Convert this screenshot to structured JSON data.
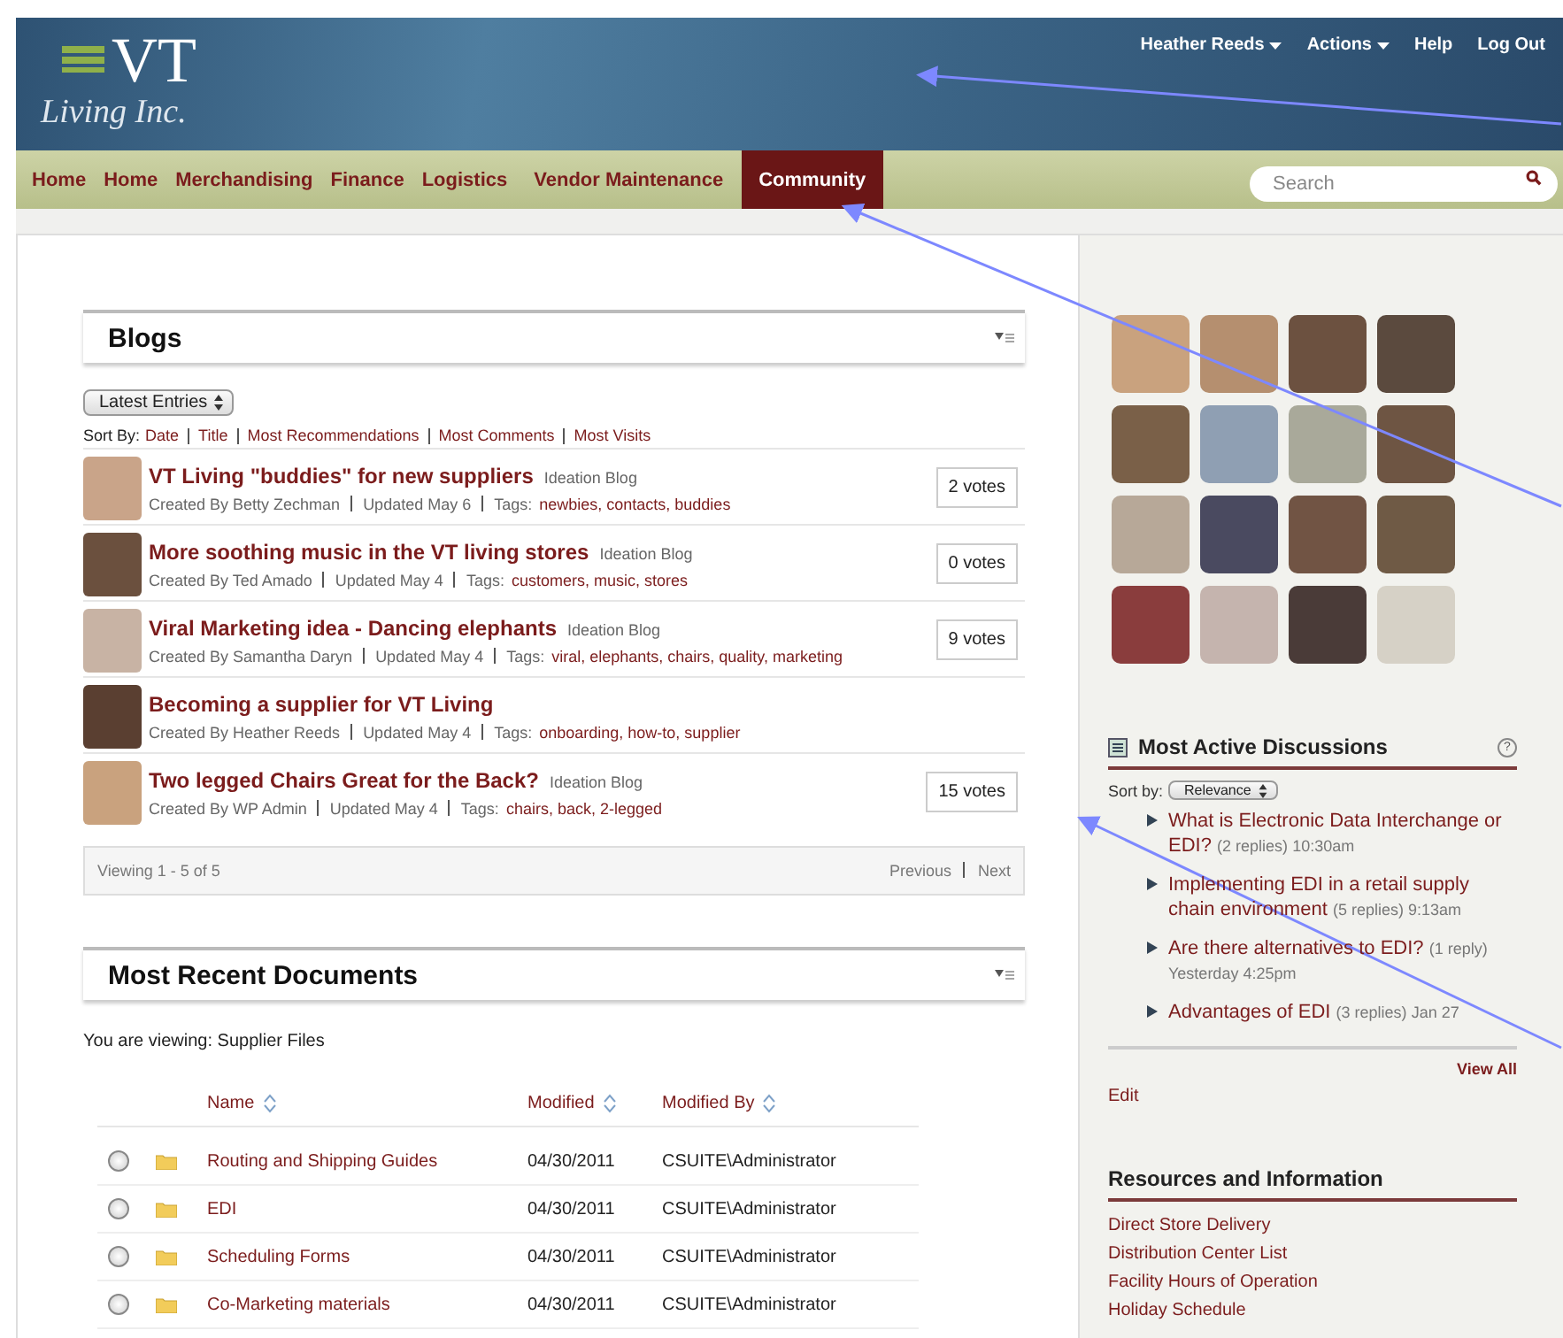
{
  "logo": {
    "mark": "VT",
    "tagline": "Living Inc."
  },
  "user_menu": [
    {
      "label": "Heather Reeds",
      "dropdown": true
    },
    {
      "label": "Actions",
      "dropdown": true
    },
    {
      "label": "Help",
      "dropdown": false
    },
    {
      "label": "Log Out",
      "dropdown": false
    }
  ],
  "nav": [
    {
      "label": "Home",
      "selected": false
    },
    {
      "label": "Home",
      "selected": false
    },
    {
      "label": "Merchandising",
      "selected": false
    },
    {
      "label": "Finance",
      "selected": false
    },
    {
      "label": "Logistics",
      "selected": false
    },
    {
      "label": "Vendor Maintenance",
      "selected": false
    },
    {
      "label": "Community",
      "selected": true
    }
  ],
  "search": {
    "placeholder": "Search"
  },
  "blogs": {
    "title": "Blogs",
    "filter": "Latest Entries",
    "sort_label": "Sort By:",
    "sort_options": [
      "Date",
      "Title",
      "Most Recommendations",
      "Most Comments",
      "Most Visits"
    ],
    "entries": [
      {
        "title": "VT Living \"buddies\" for new suppliers",
        "blog": "Ideation Blog",
        "author": "Created By Betty Zechman",
        "updated": "Updated May 6",
        "tags_label": "Tags:",
        "tags": "newbies, contacts, buddies",
        "votes": "2 votes"
      },
      {
        "title": "More soothing music in the VT living stores",
        "blog": "Ideation Blog",
        "author": "Created By Ted Amado",
        "updated": "Updated May 4",
        "tags_label": "Tags:",
        "tags": "customers, music, stores",
        "votes": "0 votes"
      },
      {
        "title": "Viral Marketing idea - Dancing elephants",
        "blog": "Ideation Blog",
        "author": "Created By Samantha Daryn",
        "updated": "Updated May 4",
        "tags_label": "Tags:",
        "tags": "viral, elephants, chairs, quality, marketing",
        "votes": "9 votes"
      },
      {
        "title": "Becoming a supplier for VT Living",
        "author": "Created By Heather Reeds",
        "updated": "Updated May 4",
        "tags_label": "Tags:",
        "tags": "onboarding, how-to, supplier"
      },
      {
        "title": "Two legged Chairs Great for the Back?",
        "blog": "Ideation Blog",
        "author": "Created By WP Admin",
        "updated": "Updated May 4",
        "tags_label": "Tags:",
        "tags": "chairs, back, 2-legged",
        "votes": "15 votes"
      }
    ],
    "viewing": "Viewing 1 - 5 of 5",
    "pager": [
      "Previous",
      "Next"
    ]
  },
  "documents": {
    "title": "Most Recent Documents",
    "location": "You are viewing: Supplier Files",
    "columns": [
      "Name",
      "Modified",
      "Modified By"
    ],
    "rows": [
      {
        "name": "Routing and Shipping Guides",
        "modified": "04/30/2011",
        "modified_by": "CSUITE\\Administrator",
        "selected": false
      },
      {
        "name": "EDI",
        "modified": "04/30/2011",
        "modified_by": "CSUITE\\Administrator",
        "selected": false
      },
      {
        "name": "Scheduling Forms",
        "modified": "04/30/2011",
        "modified_by": "CSUITE\\Administrator",
        "selected": false
      },
      {
        "name": "Co-Marketing materials",
        "modified": "04/30/2011",
        "modified_by": "CSUITE\\Administrator",
        "selected": false
      }
    ]
  },
  "discussions": {
    "title": "Most Active Discussions",
    "help": "?",
    "sort_label": "Sort by:",
    "sort_value": "Relevance",
    "items": [
      {
        "title": "What is Electronic Data Interchange or EDI?",
        "replies": "(2 replies)",
        "time": "10:30am"
      },
      {
        "title": "Implementing EDI in a retail supply chain environment",
        "replies": "(5 replies)",
        "time": "9:13am"
      },
      {
        "title": "Are there alternatives to EDI?",
        "replies": "(1 reply)",
        "time": "Yesterday 4:25pm"
      },
      {
        "title": "Advantages of EDI",
        "replies": "(3 replies)",
        "time": "Jan 27"
      }
    ],
    "view_all": "View All",
    "edit": "Edit"
  },
  "resources": {
    "title": "Resources and Information",
    "links": [
      "Direct Store Delivery",
      "Distribution Center List",
      "Facility Hours of Operation",
      "Holiday Schedule"
    ]
  }
}
